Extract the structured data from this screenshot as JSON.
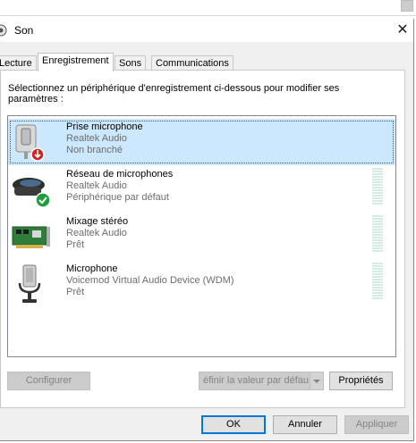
{
  "window": {
    "title": "Son",
    "close_glyph": "✕"
  },
  "tabs": [
    {
      "label": "Lecture"
    },
    {
      "label": "Enregistrement"
    },
    {
      "label": "Sons"
    },
    {
      "label": "Communications"
    }
  ],
  "active_tab": "Enregistrement",
  "instructions": "Sélectionnez un périphérique d'enregistrement ci-dessous pour modifier ses paramètres :",
  "devices": [
    {
      "name": "Prise microphone",
      "driver": "Realtek Audio",
      "status": "Non branché",
      "icon": "microphone-jack-icon",
      "badge": "unplugged-badge-icon",
      "selected": true
    },
    {
      "name": "Réseau de microphones",
      "driver": "Realtek Audio",
      "status": "Périphérique par défaut",
      "icon": "microphone-array-icon",
      "badge": "default-check-badge-icon",
      "selected": false
    },
    {
      "name": "Mixage stéréo",
      "driver": "Realtek Audio",
      "status": "Prêt",
      "icon": "sound-card-icon",
      "selected": false
    },
    {
      "name": "Microphone",
      "driver": "Voicemod Virtual Audio Device (WDM)",
      "status": "Prêt",
      "icon": "microphone-icon",
      "selected": false
    }
  ],
  "buttons": {
    "configure": "Configurer",
    "set_default": "éfinir la valeur par défau",
    "properties": "Propriétés",
    "ok": "OK",
    "cancel": "Annuler",
    "apply": "Appliquer"
  },
  "colors": {
    "selection": "#cce8ff",
    "focus_border": "#0078d7",
    "default_check": "#1e9e3a",
    "unplugged": "#d42020"
  }
}
